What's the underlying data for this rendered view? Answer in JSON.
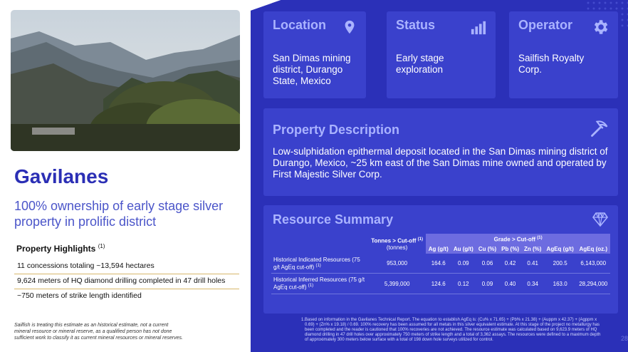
{
  "left": {
    "title": "Gavilanes",
    "subtitle": "100% ownership of early stage silver property in prolific district",
    "highlights_title": "Property Highlights",
    "highlights_sup": "(1)",
    "highlights": [
      "11 concessions totaling ~13,594 hectares",
      "9,624 meters of HQ diamond drilling completed in 47 drill holes",
      "~750 meters of strike length identified"
    ],
    "footnote": "Sailfish is treating this estimate as an historical estimate, not a current mineral resource or mineral reserve, as a qualified person has not done sufficient work to classify it as current mineral resources or mineral reserves."
  },
  "cards": {
    "location": {
      "title": "Location",
      "body": "San Dimas mining district, Durango State, Mexico",
      "icon": "map-pin-icon"
    },
    "status": {
      "title": "Status",
      "body": "Early stage exploration",
      "icon": "bar-chart-icon"
    },
    "operator": {
      "title": "Operator",
      "body": "Sailfish Royalty Corp.",
      "icon": "gear-icon"
    },
    "description": {
      "title": "Property Description",
      "body": "Low-sulphidation epithermal deposit located in the San Dimas mining district of Durango, Mexico, ~25 km east of the San Dimas mine owned and operated by First Majestic Silver Corp.",
      "icon": "pickaxe-icon"
    }
  },
  "resource": {
    "title": "Resource Summary",
    "icon": "diamond-icon",
    "tonnes_header": "Tonnes > Cut-off",
    "tonnes_sup": "(1)",
    "tonnes_unit": "(tonnes)",
    "grade_header": "Grade > Cut-off",
    "grade_sup": "(1)",
    "columns": [
      "Ag (g/t)",
      "Au (g/t)",
      "Cu (%)",
      "Pb (%)",
      "Zn (%)",
      "AgEq (g/t)",
      "AgEq (oz.)"
    ],
    "rows": [
      {
        "label": "Historical Indicated Resources (75 g/t AgEq cut-off)",
        "sup": "(1)",
        "values": [
          "953,000",
          "164.6",
          "0.09",
          "0.06",
          "0.42",
          "0.41",
          "200.5",
          "6,143,000"
        ]
      },
      {
        "label": "Historical Inferred Resources (75 g/t AgEq cut-off)",
        "sup": "(1)",
        "values": [
          "5,399,000",
          "124.6",
          "0.12",
          "0.09",
          "0.40",
          "0.34",
          "163.0",
          "28,294,000"
        ]
      }
    ]
  },
  "notes": {
    "num": "1.",
    "text": "Based on information in the Gavilanes Technical Report. The equation to establish AgEq is: (Cu% x 71.65) + (Pb% x 21.38) + (Auppm x 42.37) + (Agppm x 0.69) + (Zn% x 19.18) / 0.69. 100% recovery has been assumed for all metals in this silver equivalent estimate. At this stage of the project no metallurgy has been completed and the reader is cautioned that 100% recoveries are not achieved. The resource estimate was calculated based on 9,623.9 meters of HQ diamond drilling in 47 drill holes over approximately 750 meters of strike length and a total of 3,362 assays. The resources were defined to a maximum depth of approximately 300 meters below surface with a total of 198 down hole surveys utilized for control."
  },
  "page_number": "28",
  "colors": {
    "brand_blue": "#2b30b8",
    "card_blue": "#3a41cc",
    "title_blue": "#2b2fb5",
    "card_title": "#aab3ff",
    "divider_gold": "#d7b76a"
  }
}
